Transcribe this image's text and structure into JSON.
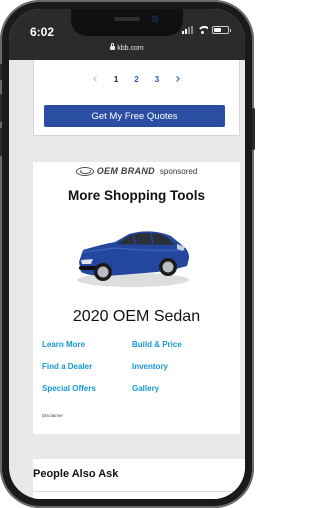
{
  "status_bar": {
    "time": "6:02",
    "url": "kbb.com"
  },
  "pagination": {
    "pages": [
      "1",
      "2",
      "3"
    ],
    "prev_icon": "chevron-left-icon",
    "next_icon": "chevron-right-icon"
  },
  "quote_button": {
    "label": "Get My Free Quotes",
    "color": "#2a4fa2"
  },
  "sponsor": {
    "brand": "OEM BRAND",
    "label": "sponsored"
  },
  "tools": {
    "title": "More Shopping Tools",
    "vehicle": "2020 OEM Sedan",
    "links": [
      "Learn More",
      "Build & Price",
      "Find a Dealer",
      "Inventory",
      "Special Offers",
      "Gallery"
    ],
    "disclaimer": "Disclaimer",
    "link_color": "#1598d6"
  },
  "people_also_ask": {
    "title": "People Also Ask"
  }
}
